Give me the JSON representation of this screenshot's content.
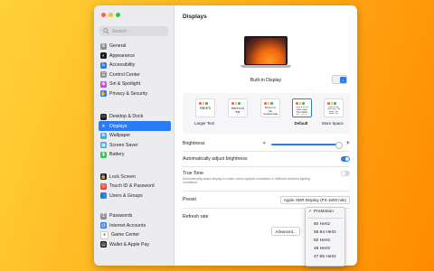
{
  "colors": {
    "accent": "#2a7cf6",
    "background_from": "#ffd23a",
    "background_to": "#ff8a00"
  },
  "search": {
    "placeholder": "Search"
  },
  "sidebar": {
    "groups": [
      [
        {
          "label": "General",
          "icon": "gear-icon",
          "color": "#8e8e93",
          "glyph": "⚙"
        },
        {
          "label": "Appearance",
          "icon": "appearance-icon",
          "color": "#1d1d1f",
          "glyph": "◐"
        },
        {
          "label": "Accessibility",
          "icon": "accessibility-icon",
          "color": "#2a7cf6",
          "glyph": "♿"
        },
        {
          "label": "Control Center",
          "icon": "control-center-icon",
          "color": "#8e8e93",
          "glyph": "☰"
        },
        {
          "label": "Siri & Spotlight",
          "icon": "siri-icon",
          "color": "#c14ad9",
          "glyph": "◉"
        },
        {
          "label": "Privacy & Security",
          "icon": "privacy-hand-icon",
          "color": "#2a7cf6",
          "glyph": "✋"
        }
      ],
      [
        {
          "label": "Desktop & Dock",
          "icon": "desktop-dock-icon",
          "color": "#1d1d1f",
          "glyph": "▭"
        },
        {
          "label": "Displays",
          "icon": "displays-icon",
          "color": "#2a7cf6",
          "glyph": "☀",
          "active": true
        },
        {
          "label": "Wallpaper",
          "icon": "wallpaper-icon",
          "color": "#38b0e8",
          "glyph": "❀"
        },
        {
          "label": "Screen Saver",
          "icon": "screen-saver-icon",
          "color": "#38b0e8",
          "glyph": "▣"
        },
        {
          "label": "Battery",
          "icon": "battery-icon",
          "color": "#34c759",
          "glyph": "▮"
        }
      ],
      [
        {
          "label": "Lock Screen",
          "icon": "lock-icon",
          "color": "#1d1d1f",
          "glyph": "🔒"
        },
        {
          "label": "Touch ID & Password",
          "icon": "fingerprint-icon",
          "color": "#ff3b30",
          "glyph": "◎"
        },
        {
          "label": "Users & Groups",
          "icon": "users-icon",
          "color": "#2a7cf6",
          "glyph": "👥"
        }
      ],
      [
        {
          "label": "Passwords",
          "icon": "key-icon",
          "color": "#8e8e93",
          "glyph": "⚿"
        },
        {
          "label": "Internet Accounts",
          "icon": "at-icon",
          "color": "#2a7cf6",
          "glyph": "@"
        },
        {
          "label": "Game Center",
          "icon": "game-center-icon",
          "color": "#ffffff",
          "glyph": "●"
        },
        {
          "label": "Wallet & Apple Pay",
          "icon": "wallet-icon",
          "color": "#1d1d1f",
          "glyph": "▤"
        }
      ]
    ]
  },
  "main": {
    "title": "Displays",
    "display_name": "Built-in Display",
    "resolution_options": [
      {
        "label": "Larger Text",
        "sample": "Here's",
        "selected": false
      },
      {
        "label": "",
        "sample": "Here's to the troublem",
        "selected": false
      },
      {
        "label": "",
        "sample": "Here's to the troublemakers. The round",
        "selected": false
      },
      {
        "label": "Default",
        "sample": "Here's to the crazy ones. The misfits. The rebels.",
        "selected": true
      },
      {
        "label": "More Space",
        "sample": "Here's to the crazy ones. The misfits. The rebels. The troublemakers.",
        "selected": false
      }
    ],
    "brightness_label": "Brightness",
    "brightness_level": 0.95,
    "auto_brightness_label": "Automatically adjust brightness",
    "auto_brightness_on": true,
    "true_tone_label": "True Tone",
    "true_tone_desc": "Automatically adapt display to make colors appear consistent in different ambient lighting conditions.",
    "true_tone_on": false,
    "preset_label": "Preset",
    "preset_value": "Apple XDR Display (P3-1600 nits)",
    "refresh_rate_label": "Refresh rate",
    "advanced_label": "Advanced..."
  },
  "refresh_popup": {
    "items": [
      "ProMotion",
      "60 Hertz",
      "59.94 Hertz",
      "50 Hertz",
      "48 Hertz",
      "47.95 Hertz"
    ],
    "selected": "ProMotion"
  }
}
